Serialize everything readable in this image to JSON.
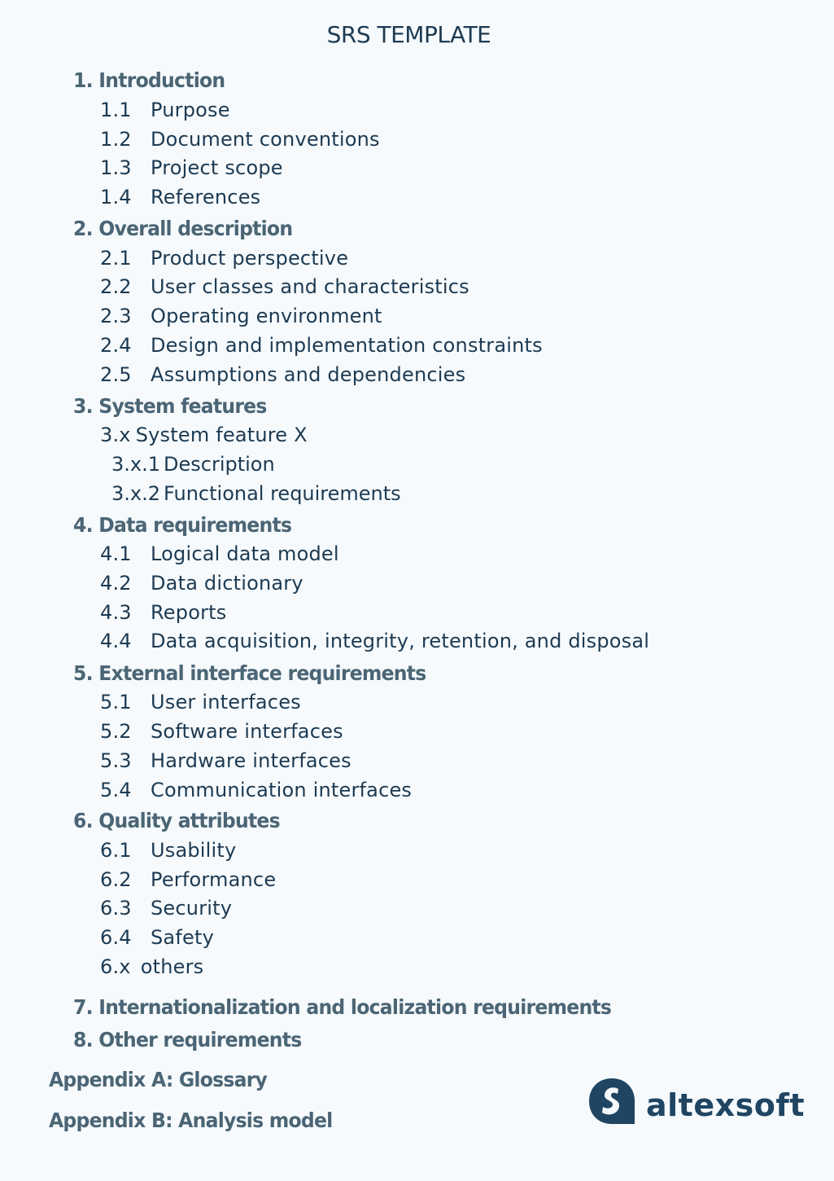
{
  "title": "SRS TEMPLATE",
  "sections": [
    {
      "num": "1.",
      "label": "Introduction"
    },
    {
      "num": "1.1",
      "label": "Purpose"
    },
    {
      "num": "1.2",
      "label": "Document conventions"
    },
    {
      "num": "1.3",
      "label": "Project scope"
    },
    {
      "num": "1.4",
      "label": "References"
    },
    {
      "num": "2.",
      "label": "Overall description"
    },
    {
      "num": "2.1",
      "label": "Product perspective"
    },
    {
      "num": "2.2",
      "label": "User classes and characteristics"
    },
    {
      "num": "2.3",
      "label": "Operating environment"
    },
    {
      "num": "2.4",
      "label": "Design and implementation constraints"
    },
    {
      "num": "2.5",
      "label": "Assumptions and dependencies"
    },
    {
      "num": "3.",
      "label": "System features"
    },
    {
      "num": "3.x",
      "label": "System feature X"
    },
    {
      "num": "3.x.1",
      "label": "Description"
    },
    {
      "num": "3.x.2",
      "label": "Functional requirements"
    },
    {
      "num": "4.",
      "label": "Data requirements"
    },
    {
      "num": "4.1",
      "label": "Logical data model"
    },
    {
      "num": "4.2",
      "label": "Data dictionary"
    },
    {
      "num": "4.3",
      "label": "Reports"
    },
    {
      "num": "4.4",
      "label": "Data acquisition, integrity, retention, and disposal"
    },
    {
      "num": "5.",
      "label": "External interface requirements"
    },
    {
      "num": "5.1",
      "label": "User interfaces"
    },
    {
      "num": "5.2",
      "label": "Software interfaces"
    },
    {
      "num": "5.3",
      "label": "Hardware interfaces"
    },
    {
      "num": "5.4",
      "label": "Communication interfaces"
    },
    {
      "num": "6.",
      "label": "Quality attributes"
    },
    {
      "num": "6.1",
      "label": "Usability"
    },
    {
      "num": "6.2",
      "label": "Performance"
    },
    {
      "num": "6.3",
      "label": "Security"
    },
    {
      "num": "6.4",
      "label": "Safety"
    },
    {
      "num": "6.x",
      "label": "others"
    },
    {
      "num": "7.",
      "label": "Internationalization and localization requirements"
    },
    {
      "num": "8.",
      "label": "Other requirements"
    }
  ],
  "appendices": [
    "Appendix A: Glossary",
    "Appendix B: Analysis model"
  ],
  "logo": {
    "text": "altexsoft",
    "icon": "altexsoft-logo-icon"
  },
  "colors": {
    "background": "#f6fafc",
    "heading": "#4b6575",
    "text": "#1d3a52",
    "brand": "#1f4562"
  }
}
